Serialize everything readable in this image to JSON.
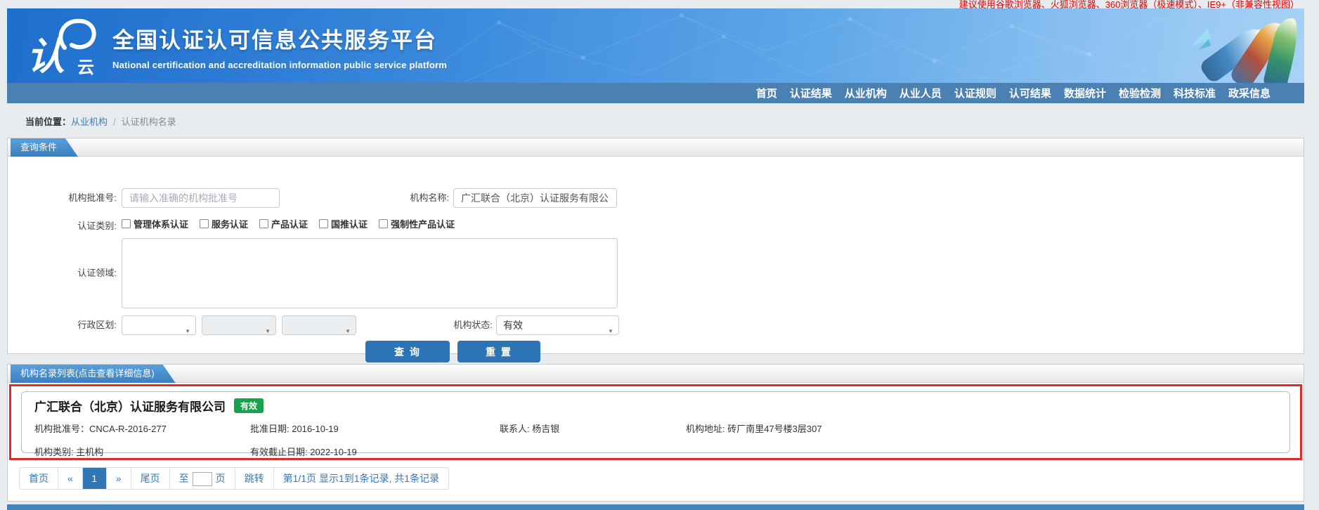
{
  "browser_notice": "建议使用谷歌浏览器、火狐浏览器、360浏览器（极速模式）、IE9+（非兼容性视图）",
  "colors": {
    "banner_blue": "#2f7fd6",
    "nav_blue": "#4a80b2",
    "accent_blue": "#3c7fbe",
    "button_blue": "#2d74b5",
    "link_blue": "#3a7bbf",
    "badge_green": "#18a24b",
    "highlight_red": "#e02b2b",
    "notice_red": "#e60000"
  },
  "header": {
    "logo_text": "认",
    "logo_cloud": "云",
    "title": "全国认证认可信息公共服务平台",
    "subtitle": "National certification and accreditation information public service platform"
  },
  "nav": {
    "items": [
      "首页",
      "认证结果",
      "从业机构",
      "从业人员",
      "认证规则",
      "认可结果",
      "数据统计",
      "检验检测",
      "科技标准",
      "政采信息"
    ]
  },
  "breadcrumb": {
    "label": "当前位置：",
    "link": "从业机构",
    "separator": "/",
    "current": "认证机构名录"
  },
  "query": {
    "tab": "查询条件",
    "approval_label": "机构批准号:",
    "approval_placeholder": "请输入准确的机构批准号",
    "name_label": "机构名称:",
    "name_value": "广汇联合（北京）认证服务有限公司",
    "category_label": "认证类别:",
    "categories": [
      "管理体系认证",
      "服务认证",
      "产品认证",
      "国推认证",
      "强制性产品认证"
    ],
    "field_label": "认证领域:",
    "region_label": "行政区划:",
    "status_label": "机构状态:",
    "status_value": "有效",
    "search_button": "查 询",
    "reset_button": "重 置"
  },
  "results": {
    "tab": "机构名录列表(点击查看详细信息)",
    "card": {
      "name": "广汇联合（北京）认证服务有限公司",
      "status_badge": "有效",
      "fields": [
        "机构批准号：CNCA-R-2016-277",
        "批准日期: 2016-10-19",
        "联系人: 杨吉银",
        "机构地址: 砖厂南里47号楼3层307",
        "机构类别: 主机构",
        "有效截止日期: 2022-10-19"
      ]
    }
  },
  "pagination": {
    "first": "首页",
    "prev": "«",
    "page": "1",
    "next": "»",
    "last": "尾页",
    "goto_prefix": "至",
    "goto_suffix": "页",
    "jump": "跳转",
    "info": "第1/1页 显示1到1条记录, 共1条记录"
  }
}
